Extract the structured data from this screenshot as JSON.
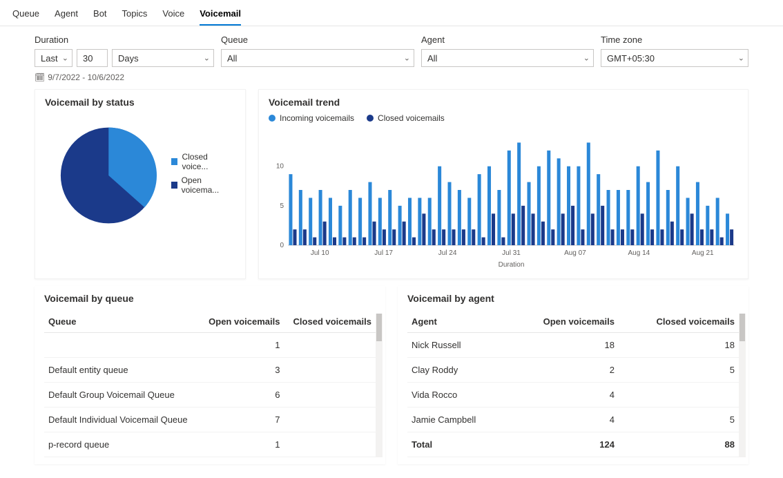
{
  "tabs": [
    "Queue",
    "Agent",
    "Bot",
    "Topics",
    "Voice",
    "Voicemail"
  ],
  "active_tab": "Voicemail",
  "filters": {
    "duration_label": "Duration",
    "duration_mode": "Last",
    "duration_value": "30",
    "duration_unit": "Days",
    "queue_label": "Queue",
    "queue_value": "All",
    "agent_label": "Agent",
    "agent_value": "All",
    "tz_label": "Time zone",
    "tz_value": "GMT+05:30"
  },
  "date_range": "9/7/2022 - 10/6/2022",
  "status_card": {
    "title": "Voicemail by status",
    "legend": [
      {
        "label": "Closed voice...",
        "color": "#2b88d8"
      },
      {
        "label": "Open voicema...",
        "color": "#1b3a8a"
      }
    ]
  },
  "trend_card": {
    "title": "Voicemail trend",
    "legend": [
      {
        "label": "Incoming voicemails",
        "color": "#2b88d8"
      },
      {
        "label": "Closed voicemails",
        "color": "#1b3a8a"
      }
    ],
    "xlabel": "Duration",
    "yticks": [
      "0",
      "5",
      "10"
    ],
    "xticks": [
      "Jul 10",
      "Jul 17",
      "Jul 24",
      "Jul 31",
      "Aug 07",
      "Aug 14",
      "Aug 21"
    ]
  },
  "queue_table": {
    "title": "Voicemail by queue",
    "cols": [
      "Queue",
      "Open voicemails",
      "Closed voicemails"
    ],
    "rows": [
      {
        "q": "",
        "open": "1",
        "closed": ""
      },
      {
        "q": "Default entity queue",
        "open": "3",
        "closed": ""
      },
      {
        "q": "Default Group Voicemail Queue",
        "open": "6",
        "closed": ""
      },
      {
        "q": "Default Individual Voicemail Queue",
        "open": "7",
        "closed": ""
      },
      {
        "q": "p-record queue",
        "open": "1",
        "closed": ""
      }
    ]
  },
  "agent_table": {
    "title": "Voicemail by agent",
    "cols": [
      "Agent",
      "Open voicemails",
      "Closed voicemails"
    ],
    "rows": [
      {
        "a": "Nick Russell",
        "open": "18",
        "closed": "18"
      },
      {
        "a": "Clay Roddy",
        "open": "2",
        "closed": "5"
      },
      {
        "a": "Vida Rocco",
        "open": "4",
        "closed": ""
      },
      {
        "a": "Jamie Campbell",
        "open": "4",
        "closed": "5"
      }
    ],
    "total": {
      "label": "Total",
      "open": "124",
      "closed": "88"
    }
  },
  "chart_data": [
    {
      "type": "pie",
      "title": "Voicemail by status",
      "series": [
        {
          "name": "Closed voicemails",
          "value": 40,
          "color": "#2b88d8"
        },
        {
          "name": "Open voicemails",
          "value": 60,
          "color": "#1b3a8a"
        }
      ]
    },
    {
      "type": "bar",
      "title": "Voicemail trend",
      "xlabel": "Duration",
      "ylim": [
        0,
        14
      ],
      "yticks": [
        0,
        5,
        10
      ],
      "xticks": [
        "Jul 10",
        "Jul 17",
        "Jul 24",
        "Jul 31",
        "Aug 07",
        "Aug 14",
        "Aug 21"
      ],
      "series": [
        {
          "name": "Incoming voicemails",
          "color": "#2b88d8",
          "values": [
            9,
            7,
            6,
            7,
            6,
            5,
            7,
            6,
            8,
            6,
            7,
            5,
            6,
            6,
            6,
            10,
            8,
            7,
            6,
            9,
            10,
            7,
            12,
            13,
            8,
            10,
            12,
            11,
            10,
            10,
            13,
            9,
            7,
            7,
            7,
            10,
            8,
            12,
            7,
            10,
            6,
            8,
            5,
            6,
            4
          ]
        },
        {
          "name": "Closed voicemails",
          "color": "#1b3a8a",
          "values": [
            2,
            2,
            1,
            3,
            1,
            1,
            1,
            1,
            3,
            2,
            2,
            3,
            1,
            4,
            2,
            2,
            2,
            2,
            2,
            1,
            4,
            1,
            4,
            5,
            4,
            3,
            2,
            4,
            5,
            2,
            4,
            5,
            2,
            2,
            2,
            4,
            2,
            2,
            3,
            2,
            4,
            2,
            2,
            1,
            2
          ]
        }
      ]
    }
  ]
}
